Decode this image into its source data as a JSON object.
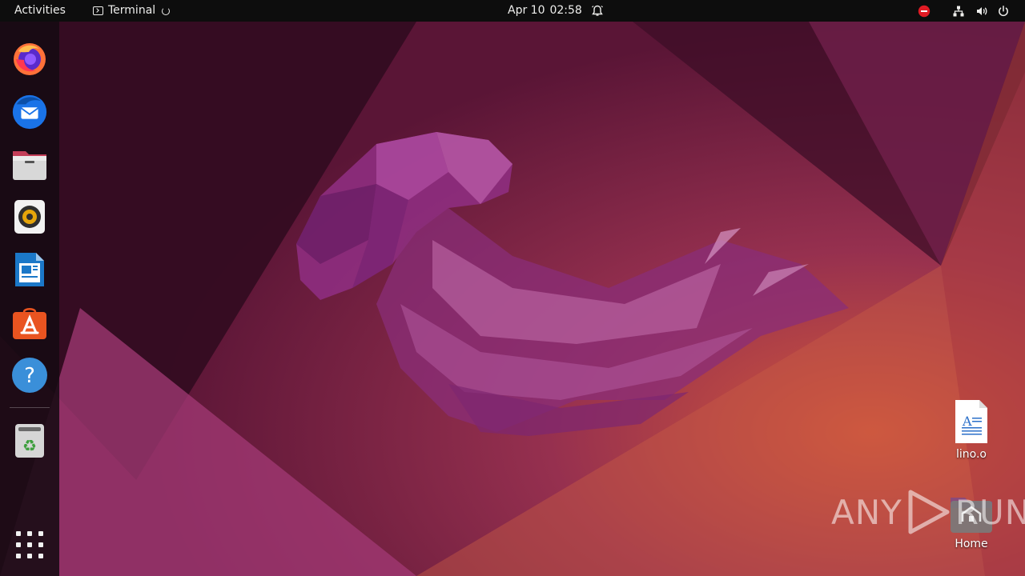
{
  "topbar": {
    "activities_label": "Activities",
    "app_name": "Terminal",
    "date": "Apr 10",
    "time": "02:58"
  },
  "dock": {
    "apps": [
      {
        "icon": "firefox-icon"
      },
      {
        "icon": "thunderbird-icon"
      },
      {
        "icon": "files-icon"
      },
      {
        "icon": "rhythmbox-icon"
      },
      {
        "icon": "libreoffice-writer-icon"
      },
      {
        "icon": "ubuntu-software-icon"
      },
      {
        "icon": "help-icon"
      },
      {
        "icon": "trash-icon"
      }
    ],
    "show_apps_icon": "app-grid-icon"
  },
  "desktop": {
    "icons": [
      {
        "label": "lino.o",
        "icon": "document-icon"
      },
      {
        "label": "Home",
        "icon": "home-folder-icon"
      }
    ]
  },
  "watermark": {
    "left_text": "ANY",
    "right_text": "RUN"
  },
  "colors": {
    "topbar_bg": "#0d0d0d",
    "wallpaper_dark": "#2b0a1c",
    "wallpaper_mid": "#7a2451",
    "wallpaper_orange": "#c9543a",
    "dnd_red": "#e01b24"
  }
}
